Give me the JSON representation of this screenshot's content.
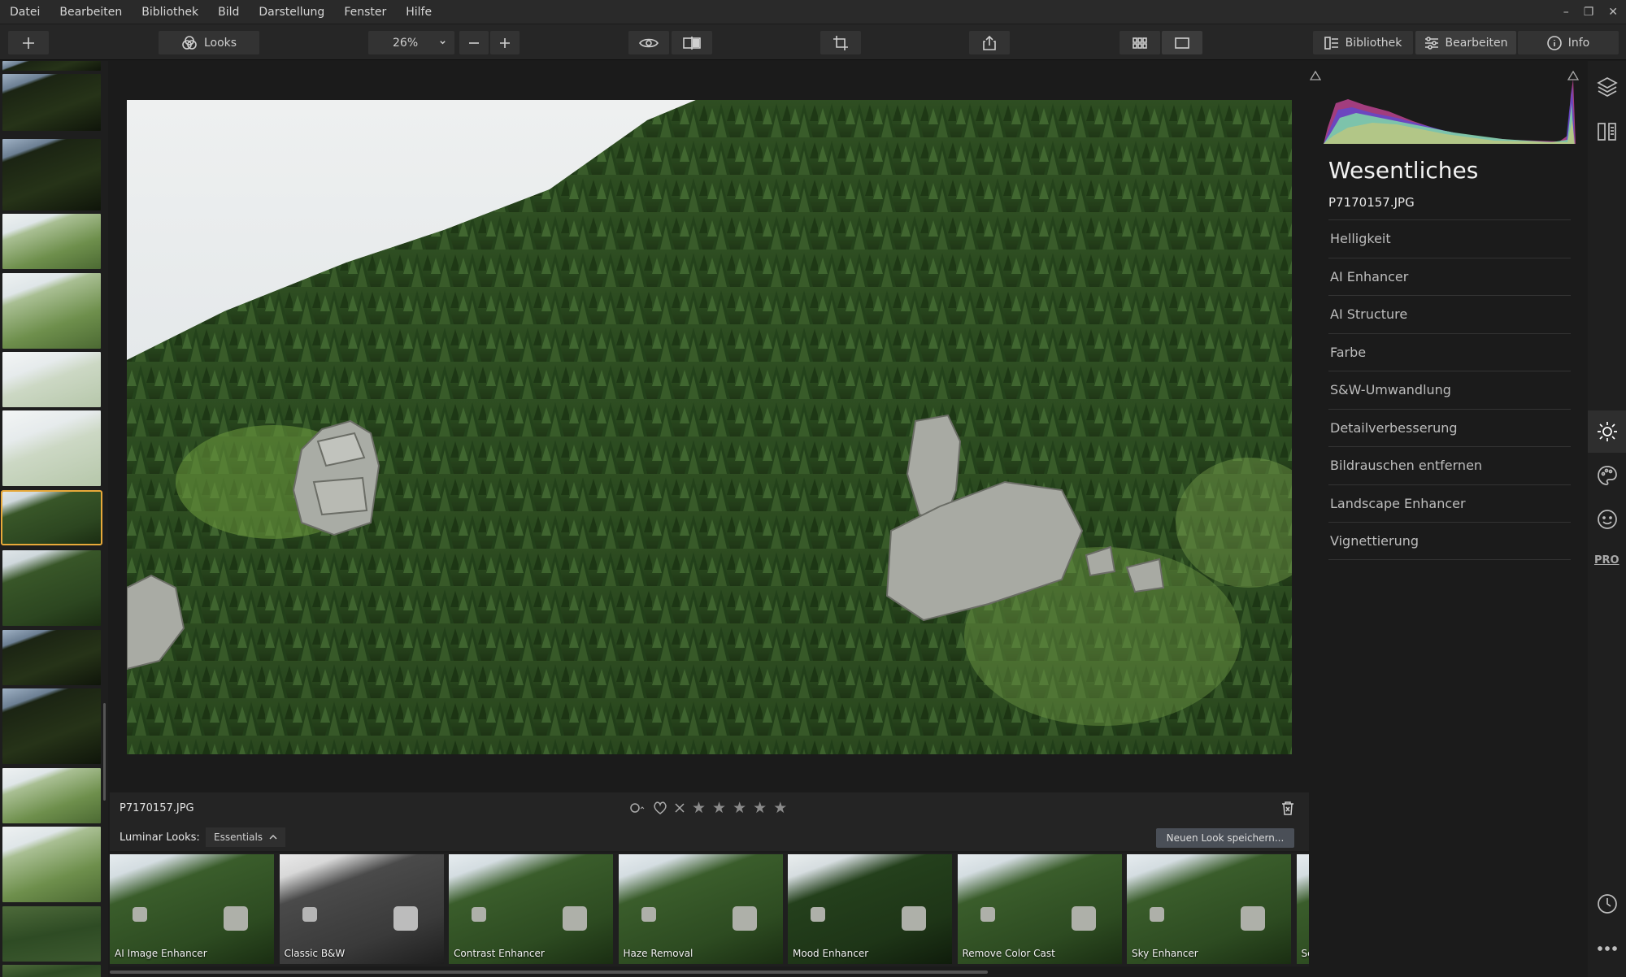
{
  "menu": [
    "Datei",
    "Bearbeiten",
    "Bibliothek",
    "Bild",
    "Darstellung",
    "Fenster",
    "Hilfe"
  ],
  "window_controls": [
    "–",
    "❐",
    "✕"
  ],
  "toolbar": {
    "add_icon": "plus-icon",
    "looks_label": "Looks",
    "zoom_value": "26%",
    "library_label": "Bibliothek",
    "edit_label": "Bearbeiten",
    "info_label": "Info"
  },
  "image": {
    "filename": "P7170157.JPG",
    "rating": 0
  },
  "looksbar": {
    "label": "Luminar Looks:",
    "category": "Essentials",
    "save_label": "Neuen Look speichern..."
  },
  "looks": [
    {
      "name": "AI Image Enhancer",
      "style": "normal"
    },
    {
      "name": "Classic B&W",
      "style": "bw"
    },
    {
      "name": "Contrast Enhancer",
      "style": "normal"
    },
    {
      "name": "Haze Removal",
      "style": "normal"
    },
    {
      "name": "Mood Enhancer",
      "style": "mood"
    },
    {
      "name": "Remove Color Cast",
      "style": "normal"
    },
    {
      "name": "Sky Enhancer",
      "style": "normal"
    },
    {
      "name": "Sc",
      "style": "normal"
    }
  ],
  "panel": {
    "title": "Wesentliches",
    "filename": "P7170157.JPG",
    "filters": [
      "Helligkeit",
      "AI Enhancer",
      "AI Structure",
      "Farbe",
      "S&W-Umwandlung",
      "Detailverbesserung",
      "Bildrauschen entfernen",
      "Landscape Enhancer",
      "Vignettierung"
    ],
    "pro_label": "PRO"
  },
  "colors": {
    "selection": "#e8a93a",
    "forest": "#2c4a22",
    "sky": "#e6ebec"
  }
}
